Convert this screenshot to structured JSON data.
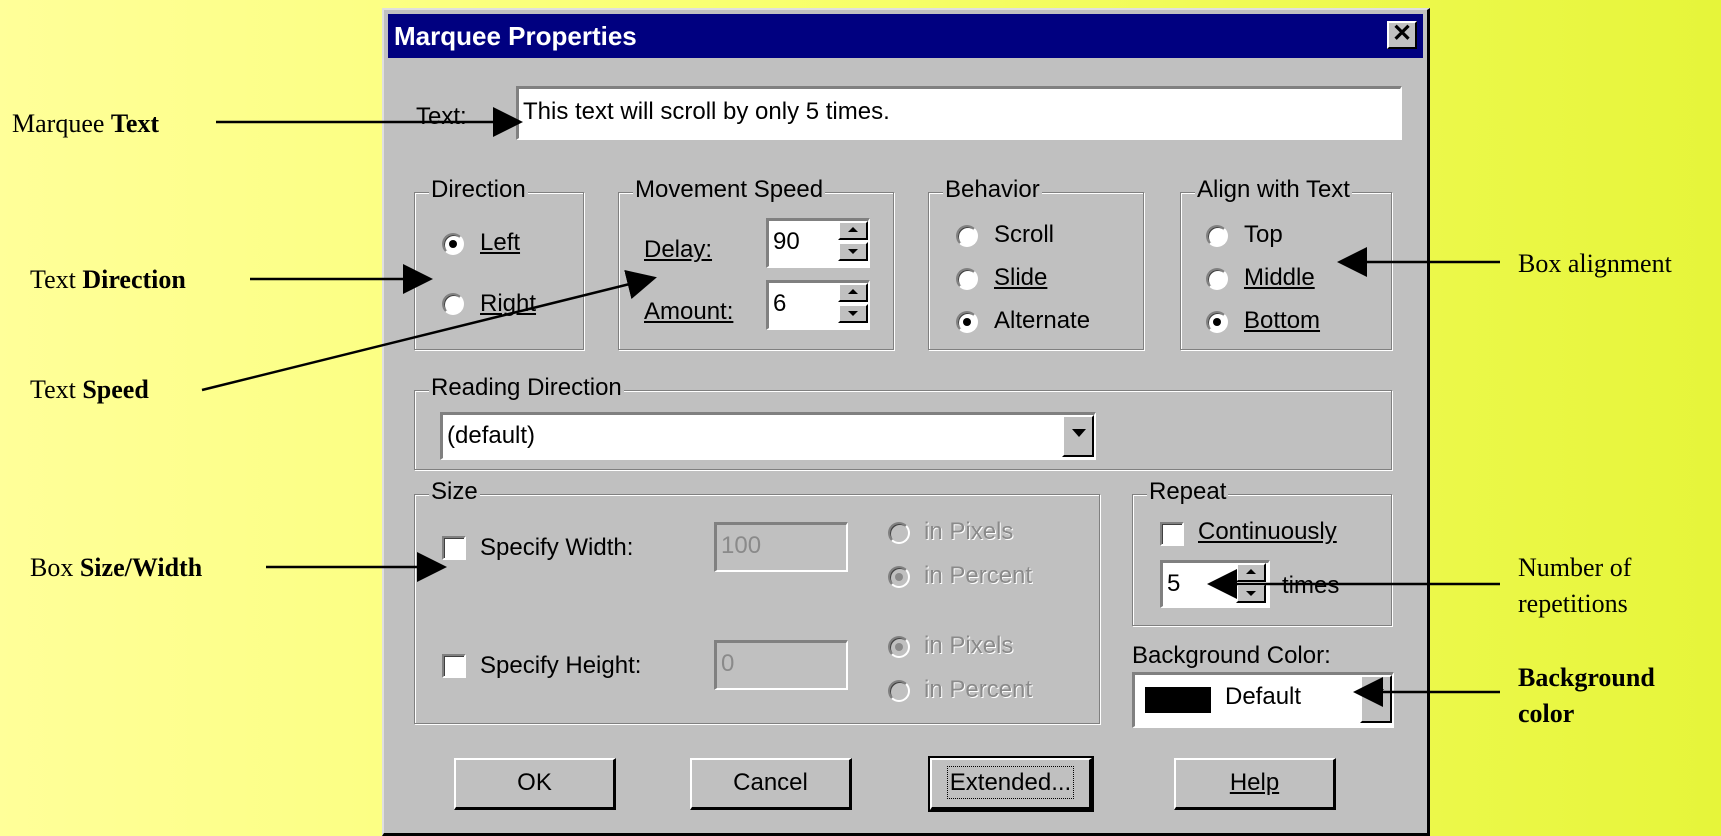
{
  "annotations": {
    "marquee_text": {
      "prefix": "Marquee ",
      "bold": "Text"
    },
    "text_direction": {
      "prefix": "Text ",
      "bold": "Direction"
    },
    "text_speed": {
      "prefix": "Text ",
      "bold": "Speed"
    },
    "box_size": {
      "prefix": "Box ",
      "bold": "Size",
      "sep": "/",
      "bold2": "Width"
    },
    "box_alignment": "Box alignment",
    "repetitions_line1": "Number of",
    "repetitions_line2": "repetitions",
    "background_line1": "Background",
    "background_line2": "color"
  },
  "dialog": {
    "title": "Marquee Properties",
    "close_glyph": "✕",
    "text_label": "Text:",
    "text_value": "This text will scroll by only 5 times.",
    "direction": {
      "title": "Direction",
      "left": "Left",
      "right": "Right",
      "selected": "Left"
    },
    "speed": {
      "title": "Movement Speed",
      "delay_label": "Delay:",
      "delay_value": "90",
      "amount_label": "Amount:",
      "amount_value": "6"
    },
    "behavior": {
      "title": "Behavior",
      "scroll": "Scroll",
      "slide": "Slide",
      "alternate": "Alternate",
      "selected": "Alternate"
    },
    "align": {
      "title": "Align with Text",
      "top": "Top",
      "middle": "Middle",
      "bottom": "Bottom",
      "selected": "Bottom"
    },
    "reading": {
      "title": "Reading Direction",
      "value": "(default)"
    },
    "size": {
      "title": "Size",
      "width_label": "Specify Width:",
      "width_value": "100",
      "height_label": "Specify Height:",
      "height_value": "0",
      "in_pixels": "in Pixels",
      "in_percent": "in Percent"
    },
    "repeat": {
      "title": "Repeat",
      "continuously": "Continuously",
      "times_value": "5",
      "times_label": "times"
    },
    "background": {
      "label": "Background Color:",
      "value": "Default",
      "swatch": "#000000"
    },
    "buttons": {
      "ok": "OK",
      "cancel": "Cancel",
      "extended": "Extended...",
      "help": "Help"
    }
  }
}
